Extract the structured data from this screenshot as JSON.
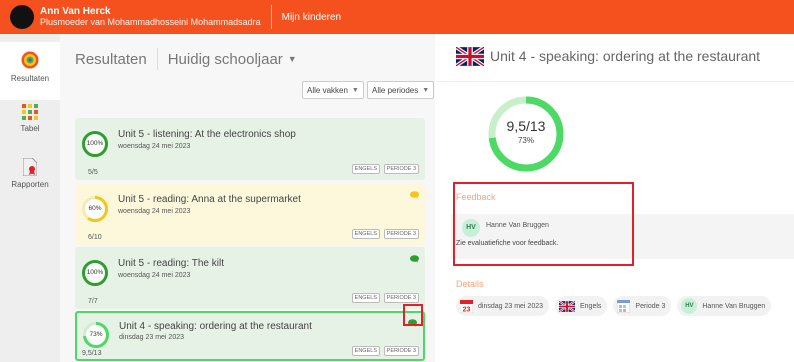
{
  "topbar": {
    "user_name": "Ann Van Herck",
    "user_role": "Plusmoeder van Mohammadhosseini Mohammadsadra",
    "link_label": "Mijn kinderen"
  },
  "sidenav": {
    "items": [
      {
        "label": "Resultaten"
      },
      {
        "label": "Tabel"
      },
      {
        "label": "Rapporten"
      }
    ]
  },
  "results": {
    "title": "Resultaten",
    "period_select": "Huidig schooljaar",
    "filters": [
      "Alle vakken",
      "Alle periodes"
    ],
    "cards": [
      {
        "title": "Unit 5 - listening: At the electronics shop",
        "date": "woensdag 24 mei 2023",
        "score": "5/5",
        "percent": "100%",
        "fraction": 1.0,
        "subject": "ENGELS",
        "period": "PERIODE 3",
        "color": "green",
        "has_comment": false
      },
      {
        "title": "Unit 5 - reading: Anna at the supermarket",
        "date": "woensdag 24 mei 2023",
        "score": "6/10",
        "percent": "60%",
        "fraction": 0.6,
        "subject": "ENGELS",
        "period": "PERIODE 3",
        "color": "yellow",
        "has_comment": true
      },
      {
        "title": "Unit 5 - reading: The kilt",
        "date": "woensdag 24 mei 2023",
        "score": "7/7",
        "percent": "100%",
        "fraction": 1.0,
        "subject": "ENGELS",
        "period": "PERIODE 3",
        "color": "green",
        "has_comment": true
      },
      {
        "title": "Unit 4 - speaking: ordering at the restaurant",
        "date": "dinsdag 23 mei 2023",
        "score": "9,5/13",
        "percent": "73%",
        "fraction": 0.73,
        "subject": "ENGELS",
        "period": "PERIODE 3",
        "color": "green",
        "has_comment": true,
        "selected": true
      }
    ]
  },
  "detail": {
    "title": "Unit 4 - speaking: ordering at the restaurant",
    "score": "9,5/13",
    "percent": "73%",
    "fraction": 0.73,
    "feedback_label": "Feedback",
    "teacher_initials": "HV",
    "teacher_name": "Hanne Van Bruggen",
    "feedback_text": "Zie evaluatiefiche voor feedback.",
    "details_label": "Details",
    "date_day": "23",
    "date": "dinsdag 23 mei 2023",
    "subject": "Engels",
    "period": "Periode 3",
    "teacher_chip_name": "Hanne Van Bruggen"
  },
  "colors": {
    "brand": "#f4511e",
    "success": "#4cd964",
    "warning": "#f5c518",
    "highlight": "#e0202a"
  }
}
